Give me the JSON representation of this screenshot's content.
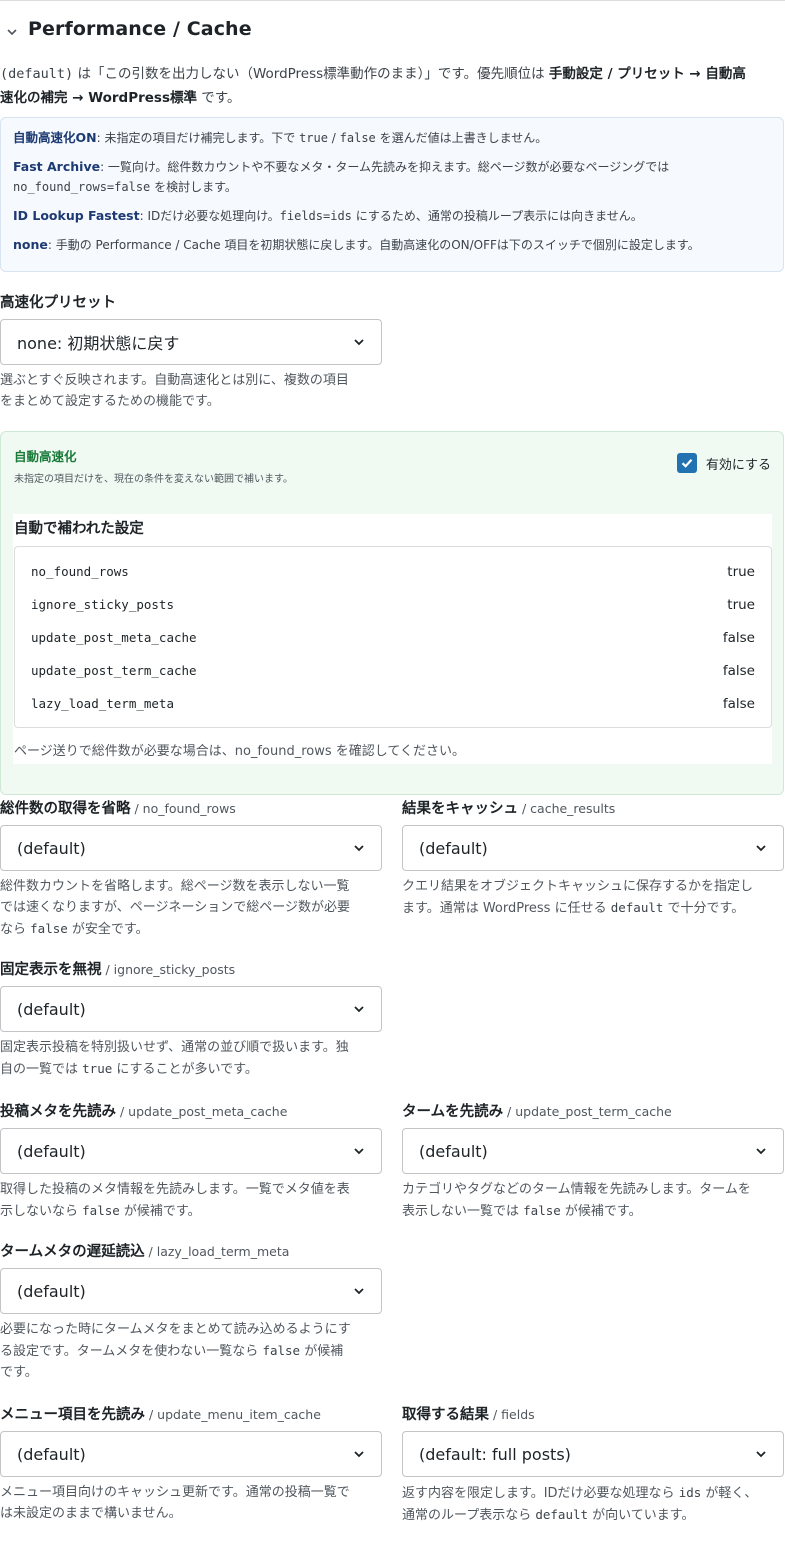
{
  "section": {
    "title": "Performance / Cache"
  },
  "intro": {
    "p1": "(default)",
    "p2": " は「この引数を出力しない（WordPress標準動作のまま）」です。優先順位は ",
    "p3": "手動設定 / プリセット → 自動高",
    "p4": "速化の補完 → WordPress標準",
    "p5": " です。"
  },
  "info": {
    "auto_on_term": "自動高速化ON",
    "auto_on_a": ": 未指定の項目だけ補完します。下で ",
    "auto_on_code1": "true",
    "auto_on_b": " / ",
    "auto_on_code2": "false",
    "auto_on_c": " を選んだ値は上書きしません。",
    "fast_term": "Fast Archive",
    "fast_a": ": 一覧向け。総件数カウントや不要なメタ・ターム先読みを抑えます。総ページ数が必要なページングでは",
    "fast_code": "no_found_rows=false",
    "fast_b": " を検討します。",
    "idl_term": "ID Lookup Fastest",
    "idl_a": ": IDだけ必要な処理向け。",
    "idl_code": "fields=ids",
    "idl_b": " にするため、通常の投稿ループ表示には向きません。",
    "none_term": "none",
    "none_a": ": 手動の Performance / Cache 項目を初期状態に戻します。自動高速化のON/OFFは下のスイッチで個別に設定します。"
  },
  "preset": {
    "label": "高速化プリセット",
    "value": "none: 初期状態に戻す",
    "help_line1": "選ぶとすぐ反映されます。自動高速化とは別に、複数の項目",
    "help_line2": "をまとめて設定するための機能です。"
  },
  "auto": {
    "title": "自動高速化",
    "desc": "未指定の項目だけを、現在の条件を変えない範囲で補います。",
    "toggle_label": "有効にする",
    "checked": true,
    "filled_title": "自動で補われた設定",
    "rows": [
      {
        "key": "no_found_rows",
        "value": "true"
      },
      {
        "key": "ignore_sticky_posts",
        "value": "true"
      },
      {
        "key": "update_post_meta_cache",
        "value": "false"
      },
      {
        "key": "update_post_term_cache",
        "value": "false"
      },
      {
        "key": "lazy_load_term_meta",
        "value": "false"
      }
    ],
    "note": "ページ送りで総件数が必要な場合は、no_found_rows を確認してください。"
  },
  "fields": {
    "no_found_rows": {
      "label": "総件数の取得を省略",
      "sub": " / no_found_rows",
      "value": "(default)",
      "help_line1": "総件数カウントを省略します。総ページ数を表示しない一覧",
      "help_line2": "では速くなりますが、ページネーションで総ページ数が必要",
      "help_line3a": "なら ",
      "help_code": "false",
      "help_line3b": " が安全です。"
    },
    "cache_results": {
      "label": "結果をキャッシュ",
      "sub": " / cache_results",
      "value": "(default)",
      "help_line1": "クエリ結果をオブジェクトキャッシュに保存するかを指定し",
      "help_line2a": "ます。通常は WordPress に任せる ",
      "help_code": "default",
      "help_line2b": " で十分です。"
    },
    "ignore_sticky_posts": {
      "label": "固定表示を無視",
      "sub": " / ignore_sticky_posts",
      "value": "(default)",
      "help_line1": "固定表示投稿を特別扱いせず、通常の並び順で扱います。独",
      "help_line2a": "自の一覧では ",
      "help_code": "true",
      "help_line2b": " にすることが多いです。"
    },
    "update_post_meta_cache": {
      "label": "投稿メタを先読み",
      "sub": " / update_post_meta_cache",
      "value": "(default)",
      "help_line1": "取得した投稿のメタ情報を先読みします。一覧でメタ値を表",
      "help_line2a": "示しないなら ",
      "help_code": "false",
      "help_line2b": " が候補です。"
    },
    "update_post_term_cache": {
      "label": "タームを先読み",
      "sub": " / update_post_term_cache",
      "value": "(default)",
      "help_line1": "カテゴリやタグなどのターム情報を先読みします。タームを",
      "help_line2a": "表示しない一覧では ",
      "help_code": "false",
      "help_line2b": " が候補です。"
    },
    "lazy_load_term_meta": {
      "label": "タームメタの遅延読込",
      "sub": " / lazy_load_term_meta",
      "value": "(default)",
      "help_line1": "必要になった時にタームメタをまとめて読み込めるようにす",
      "help_line2a": "る設定です。タームメタを使わない一覧なら ",
      "help_code": "false",
      "help_line2b": " が候補",
      "help_line3": "です。"
    },
    "update_menu_item_cache": {
      "label": "メニュー項目を先読み",
      "sub": " / update_menu_item_cache",
      "value": "(default)",
      "help_line1": "メニュー項目向けのキャッシュ更新です。通常の投稿一覧で",
      "help_line2": "は未設定のままで構いません。"
    },
    "fields": {
      "label": "取得する結果",
      "sub": " / fields",
      "value": "(default: full posts)",
      "help_line1a": "返す内容を限定します。IDだけ必要な処理なら ",
      "help_code1": "ids",
      "help_line1b": " が軽く、",
      "help_line2a": "通常のループ表示なら ",
      "help_code2": "default",
      "help_line2b": " が向いています。"
    }
  }
}
